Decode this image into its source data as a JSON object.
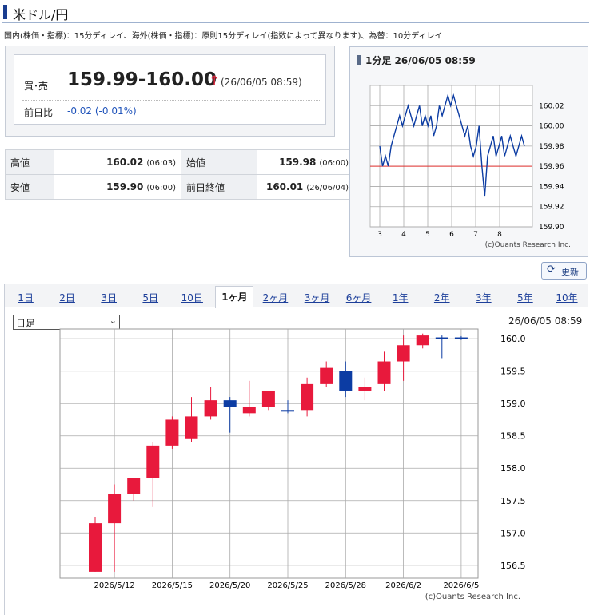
{
  "title": "米ドル/円",
  "delay_note": "国内(株価・指標)：15分ディレイ、海外(株価・指標)：原則15分ディレイ(指数によって異なります)、為替：10分ディレイ",
  "quote": {
    "bid_label": "買･売",
    "bid_value": "159.99-160.00",
    "arrow": "↑",
    "time": "(26/06/05 08:59)",
    "change_label": "前日比",
    "change_value": "-0.02 (-0.01%)"
  },
  "stats": {
    "high_label": "高値",
    "high_value": "160.02",
    "high_time": "(06:03)",
    "open_label": "始値",
    "open_value": "159.98",
    "open_time": "(06:00)",
    "low_label": "安値",
    "low_value": "159.90",
    "low_time": "(06:00)",
    "prev_label": "前日終値",
    "prev_value": "160.01",
    "prev_time": "(26/06/04)"
  },
  "mini": {
    "title": "1分足 26/06/05 08:59",
    "credit": "(c)Ouants Research Inc."
  },
  "update_label": "更新",
  "tabs": [
    "1日",
    "2日",
    "3日",
    "5日",
    "10日",
    "1ヶ月",
    "2ヶ月",
    "3ヶ月",
    "6ヶ月",
    "1年",
    "2年",
    "3年",
    "5年",
    "10年"
  ],
  "active_tab": "1ヶ月",
  "period_select": "日足",
  "main_time": "26/06/05 08:59",
  "main_credit": "(c)Ouants Research Inc.",
  "colors": {
    "up": "#e8193c",
    "down": "#0c3ca3",
    "ref_line": "#e0302f",
    "minute_line": "#0c3ca3"
  },
  "chart_data": [
    {
      "type": "line",
      "title": "1分足 26/06/05 08:59",
      "x_ticks": [
        "3",
        "4",
        "5",
        "6",
        "7",
        "8"
      ],
      "y_ticks": [
        "160.02",
        "160.00",
        "159.98",
        "159.96",
        "159.94",
        "159.92",
        "159.90"
      ],
      "ylim": [
        159.9,
        160.04
      ],
      "reference_line": 159.96,
      "series": [
        {
          "values": [
            159.98,
            159.96,
            159.97,
            159.96,
            159.98,
            159.99,
            160.0,
            160.01,
            160.0,
            160.01,
            160.02,
            160.01,
            160.0,
            160.01,
            160.02,
            160.0,
            160.01,
            160.0,
            160.01,
            159.99,
            160.0,
            160.02,
            160.01,
            160.02,
            160.03,
            160.02,
            160.03,
            160.02,
            160.01,
            160.0,
            159.99,
            160.0,
            159.98,
            159.97,
            159.98,
            160.0,
            159.96,
            159.93,
            159.97,
            159.98,
            159.99,
            159.97,
            159.98,
            159.99,
            159.97,
            159.98,
            159.99,
            159.98,
            159.97,
            159.98,
            159.99,
            159.98
          ]
        }
      ]
    },
    {
      "type": "candlestick",
      "period": "日足",
      "x_ticks": [
        "2026/5/12",
        "2026/5/15",
        "2026/5/20",
        "2026/5/25",
        "2026/5/28",
        "2026/6/2",
        "2026/6/5"
      ],
      "y_ticks": [
        "160.0",
        "159.5",
        "159.0",
        "158.5",
        "158.0",
        "157.5",
        "157.0",
        "156.5"
      ],
      "ylim": [
        156.3,
        160.15
      ],
      "candles": [
        {
          "date": "2026/5/11",
          "open": 156.4,
          "high": 157.25,
          "low": 156.4,
          "close": 157.15
        },
        {
          "date": "2026/5/12",
          "open": 157.15,
          "high": 157.75,
          "low": 156.4,
          "close": 157.6
        },
        {
          "date": "2026/5/13",
          "open": 157.6,
          "high": 157.85,
          "low": 157.5,
          "close": 157.85
        },
        {
          "date": "2026/5/14",
          "open": 157.85,
          "high": 158.4,
          "low": 157.4,
          "close": 158.35
        },
        {
          "date": "2026/5/15",
          "open": 158.35,
          "high": 158.8,
          "low": 158.3,
          "close": 158.75
        },
        {
          "date": "2026/5/18",
          "open": 158.45,
          "high": 159.1,
          "low": 158.4,
          "close": 158.8
        },
        {
          "date": "2026/5/19",
          "open": 158.8,
          "high": 159.25,
          "low": 158.75,
          "close": 159.05
        },
        {
          "date": "2026/5/20",
          "open": 159.05,
          "high": 159.1,
          "low": 158.55,
          "close": 158.95
        },
        {
          "date": "2026/5/21",
          "open": 158.85,
          "high": 159.35,
          "low": 158.8,
          "close": 158.95
        },
        {
          "date": "2026/5/22",
          "open": 158.95,
          "high": 159.2,
          "low": 158.9,
          "close": 159.2
        },
        {
          "date": "2026/5/25",
          "open": 158.9,
          "high": 159.05,
          "low": 158.85,
          "close": 158.88
        },
        {
          "date": "2026/5/26",
          "open": 158.9,
          "high": 159.4,
          "low": 158.8,
          "close": 159.3
        },
        {
          "date": "2026/5/27",
          "open": 159.3,
          "high": 159.65,
          "low": 159.25,
          "close": 159.55
        },
        {
          "date": "2026/5/28",
          "open": 159.5,
          "high": 159.65,
          "low": 159.1,
          "close": 159.2
        },
        {
          "date": "2026/5/29",
          "open": 159.2,
          "high": 159.4,
          "low": 159.05,
          "close": 159.25
        },
        {
          "date": "2026/6/1",
          "open": 159.3,
          "high": 159.8,
          "low": 159.2,
          "close": 159.65
        },
        {
          "date": "2026/6/2",
          "open": 159.65,
          "high": 160.05,
          "low": 159.35,
          "close": 159.9
        },
        {
          "date": "2026/6/3",
          "open": 159.9,
          "high": 160.08,
          "low": 159.85,
          "close": 160.05
        },
        {
          "date": "2026/6/4",
          "open": 160.02,
          "high": 160.05,
          "low": 159.7,
          "close": 160.01
        },
        {
          "date": "2026/6/5",
          "open": 160.02,
          "high": 160.04,
          "low": 159.98,
          "close": 159.99
        }
      ]
    }
  ]
}
